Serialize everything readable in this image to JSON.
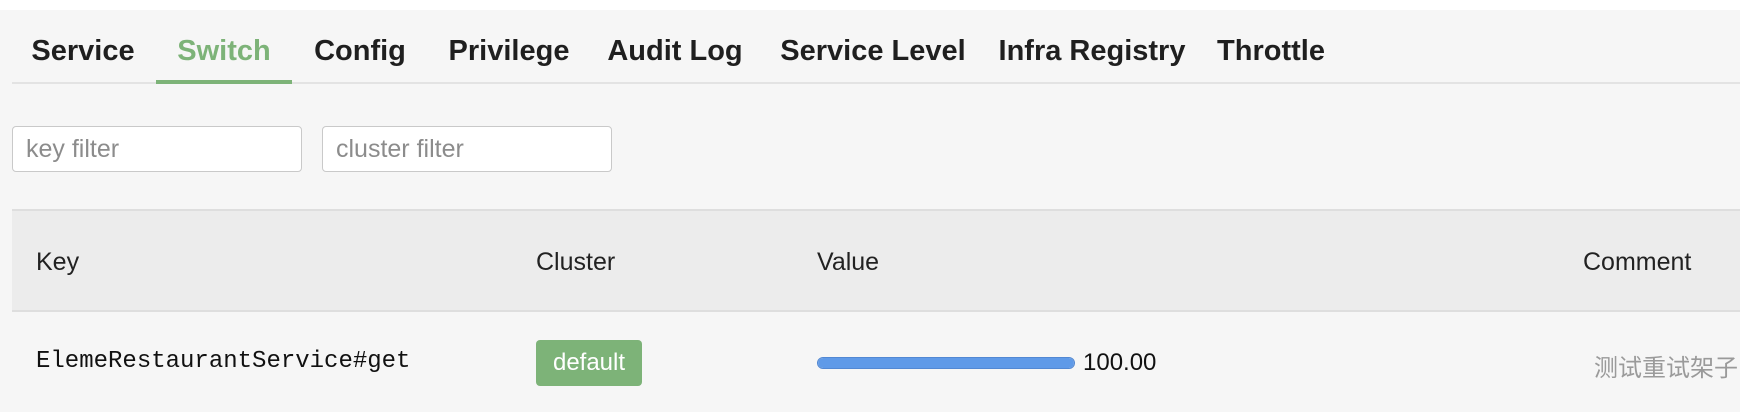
{
  "tabs": [
    {
      "label": "Service",
      "active": false
    },
    {
      "label": "Switch",
      "active": true
    },
    {
      "label": "Config",
      "active": false
    },
    {
      "label": "Privilege",
      "active": false
    },
    {
      "label": "Audit Log",
      "active": false
    },
    {
      "label": "Service Level",
      "active": false
    },
    {
      "label": "Infra Registry",
      "active": false
    },
    {
      "label": "Throttle",
      "active": false
    }
  ],
  "filters": {
    "key_placeholder": "key filter",
    "key_value": "",
    "cluster_placeholder": "cluster filter",
    "cluster_value": ""
  },
  "table": {
    "headers": {
      "key": "Key",
      "cluster": "Cluster",
      "value": "Value",
      "comment": "Comment"
    },
    "rows": [
      {
        "key": "ElemeRestaurantService#get",
        "cluster": "default",
        "value": "100.00",
        "value_fraction": 1.0,
        "comment": "测试重试架子"
      }
    ]
  },
  "colors": {
    "accent_green": "#7db378",
    "progress_blue": "#5f9ae8",
    "page_background": "#f6f6f6",
    "header_background": "#ececec"
  }
}
